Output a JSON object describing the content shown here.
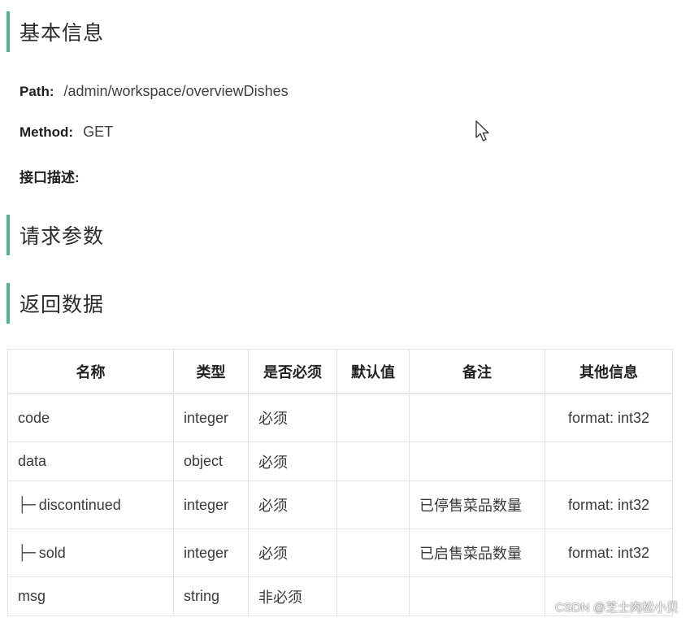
{
  "sections": {
    "basic_info": "基本信息",
    "request_params": "请求参数",
    "response_data": "返回数据"
  },
  "meta": {
    "path_label": "Path:",
    "path_value": "/admin/workspace/overviewDishes",
    "method_label": "Method:",
    "method_value": "GET",
    "desc_label": "接口描述:"
  },
  "table": {
    "headers": [
      "名称",
      "类型",
      "是否必须",
      "默认值",
      "备注",
      "其他信息"
    ],
    "rows": [
      {
        "name": "code",
        "type": "integer",
        "required": "必须",
        "default": "",
        "note": "",
        "other": "format: int32"
      },
      {
        "name": "data",
        "type": "object",
        "required": "必须",
        "default": "",
        "note": "",
        "other": ""
      },
      {
        "name": "discontinued",
        "type": "integer",
        "required": "必须",
        "default": "",
        "note": "已停售菜品数量",
        "other": "format: int32"
      },
      {
        "name": "sold",
        "type": "integer",
        "required": "必须",
        "default": "",
        "note": "已启售菜品数量",
        "other": "format: int32"
      },
      {
        "name": "msg",
        "type": "string",
        "required": "非必须",
        "default": "",
        "note": "",
        "other": ""
      }
    ],
    "tree_prefix": "├─"
  },
  "watermark": "CSDN @芝士肉松小贝",
  "colors": {
    "accent": "#52b68c",
    "border": "#e4e4e4"
  },
  "icons": {
    "cursor": "mouse-pointer-icon"
  }
}
